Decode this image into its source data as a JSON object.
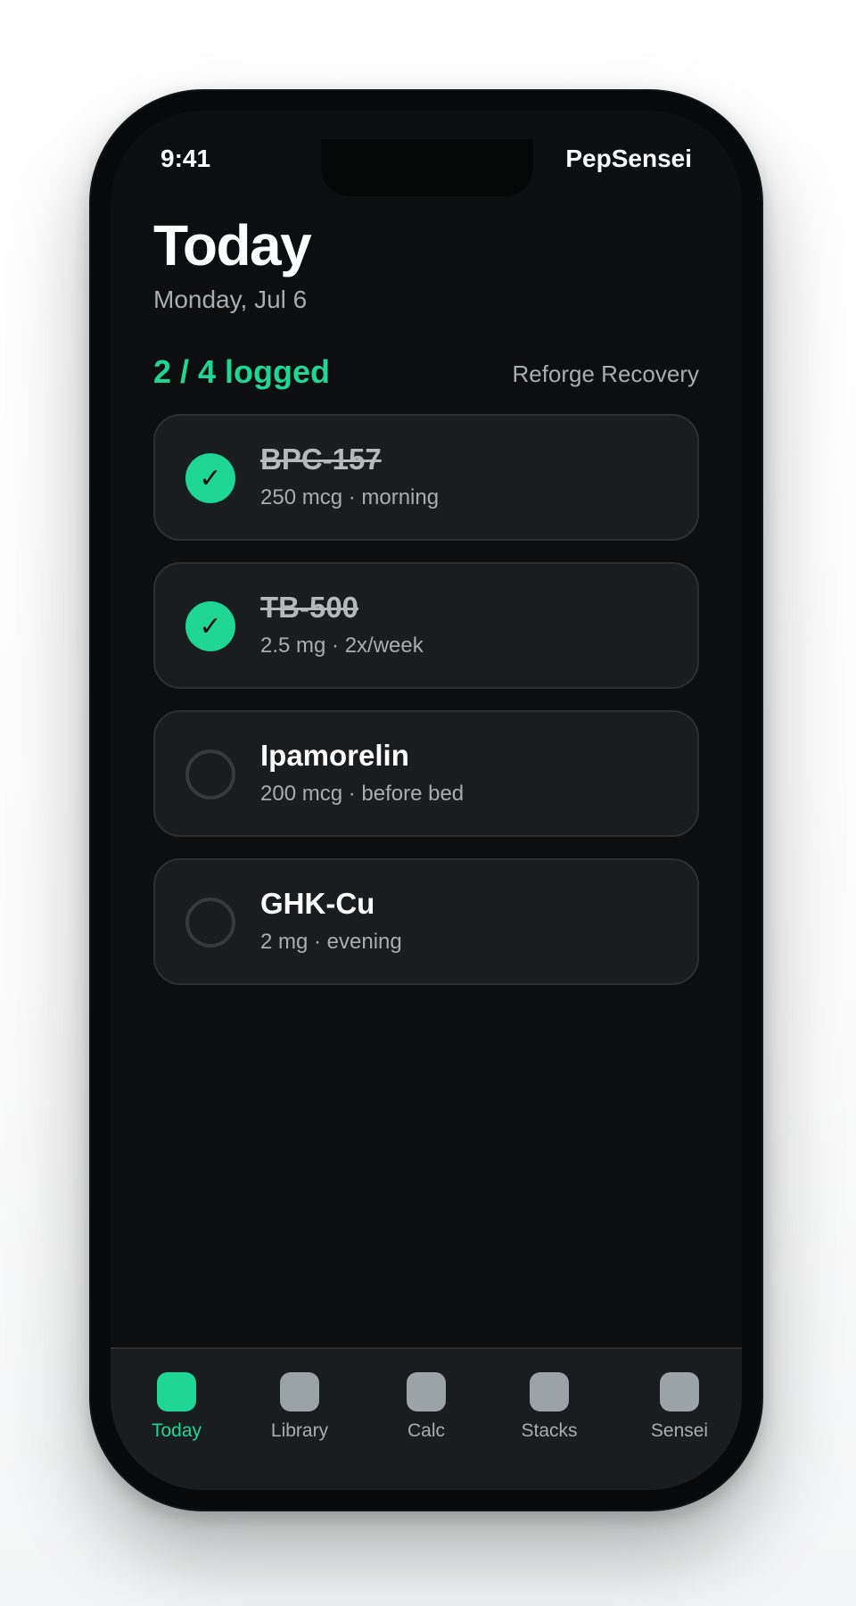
{
  "status_bar": {
    "time": "9:41",
    "app_name": "PepSensei"
  },
  "header": {
    "title": "Today",
    "date": "Monday, Jul 6"
  },
  "summary": {
    "logged": "2 / 4 logged",
    "stack_name": "Reforge Recovery"
  },
  "doses": [
    {
      "name": "BPC-157",
      "detail": "250 mcg · morning",
      "logged": true,
      "check_glyph": "✓"
    },
    {
      "name": "TB-500",
      "detail": "2.5 mg · 2x/week",
      "logged": true,
      "check_glyph": "✓"
    },
    {
      "name": "Ipamorelin",
      "detail": "200 mcg · before bed",
      "logged": false,
      "check_glyph": ""
    },
    {
      "name": "GHK-Cu",
      "detail": "2 mg · evening",
      "logged": false,
      "check_glyph": ""
    }
  ],
  "tabs": [
    {
      "label": "Today",
      "active": true,
      "icon": "today-icon"
    },
    {
      "label": "Library",
      "active": false,
      "icon": "library-icon"
    },
    {
      "label": "Calc",
      "active": false,
      "icon": "calc-icon"
    },
    {
      "label": "Stacks",
      "active": false,
      "icon": "stacks-icon"
    },
    {
      "label": "Sensei",
      "active": false,
      "icon": "sensei-icon"
    }
  ],
  "colors": {
    "accent": "#1fd694",
    "background": "#0c0e0f",
    "card": "#1a1d1f",
    "muted_text": "#a7adb0",
    "inactive_icon": "#9aa3a6"
  }
}
